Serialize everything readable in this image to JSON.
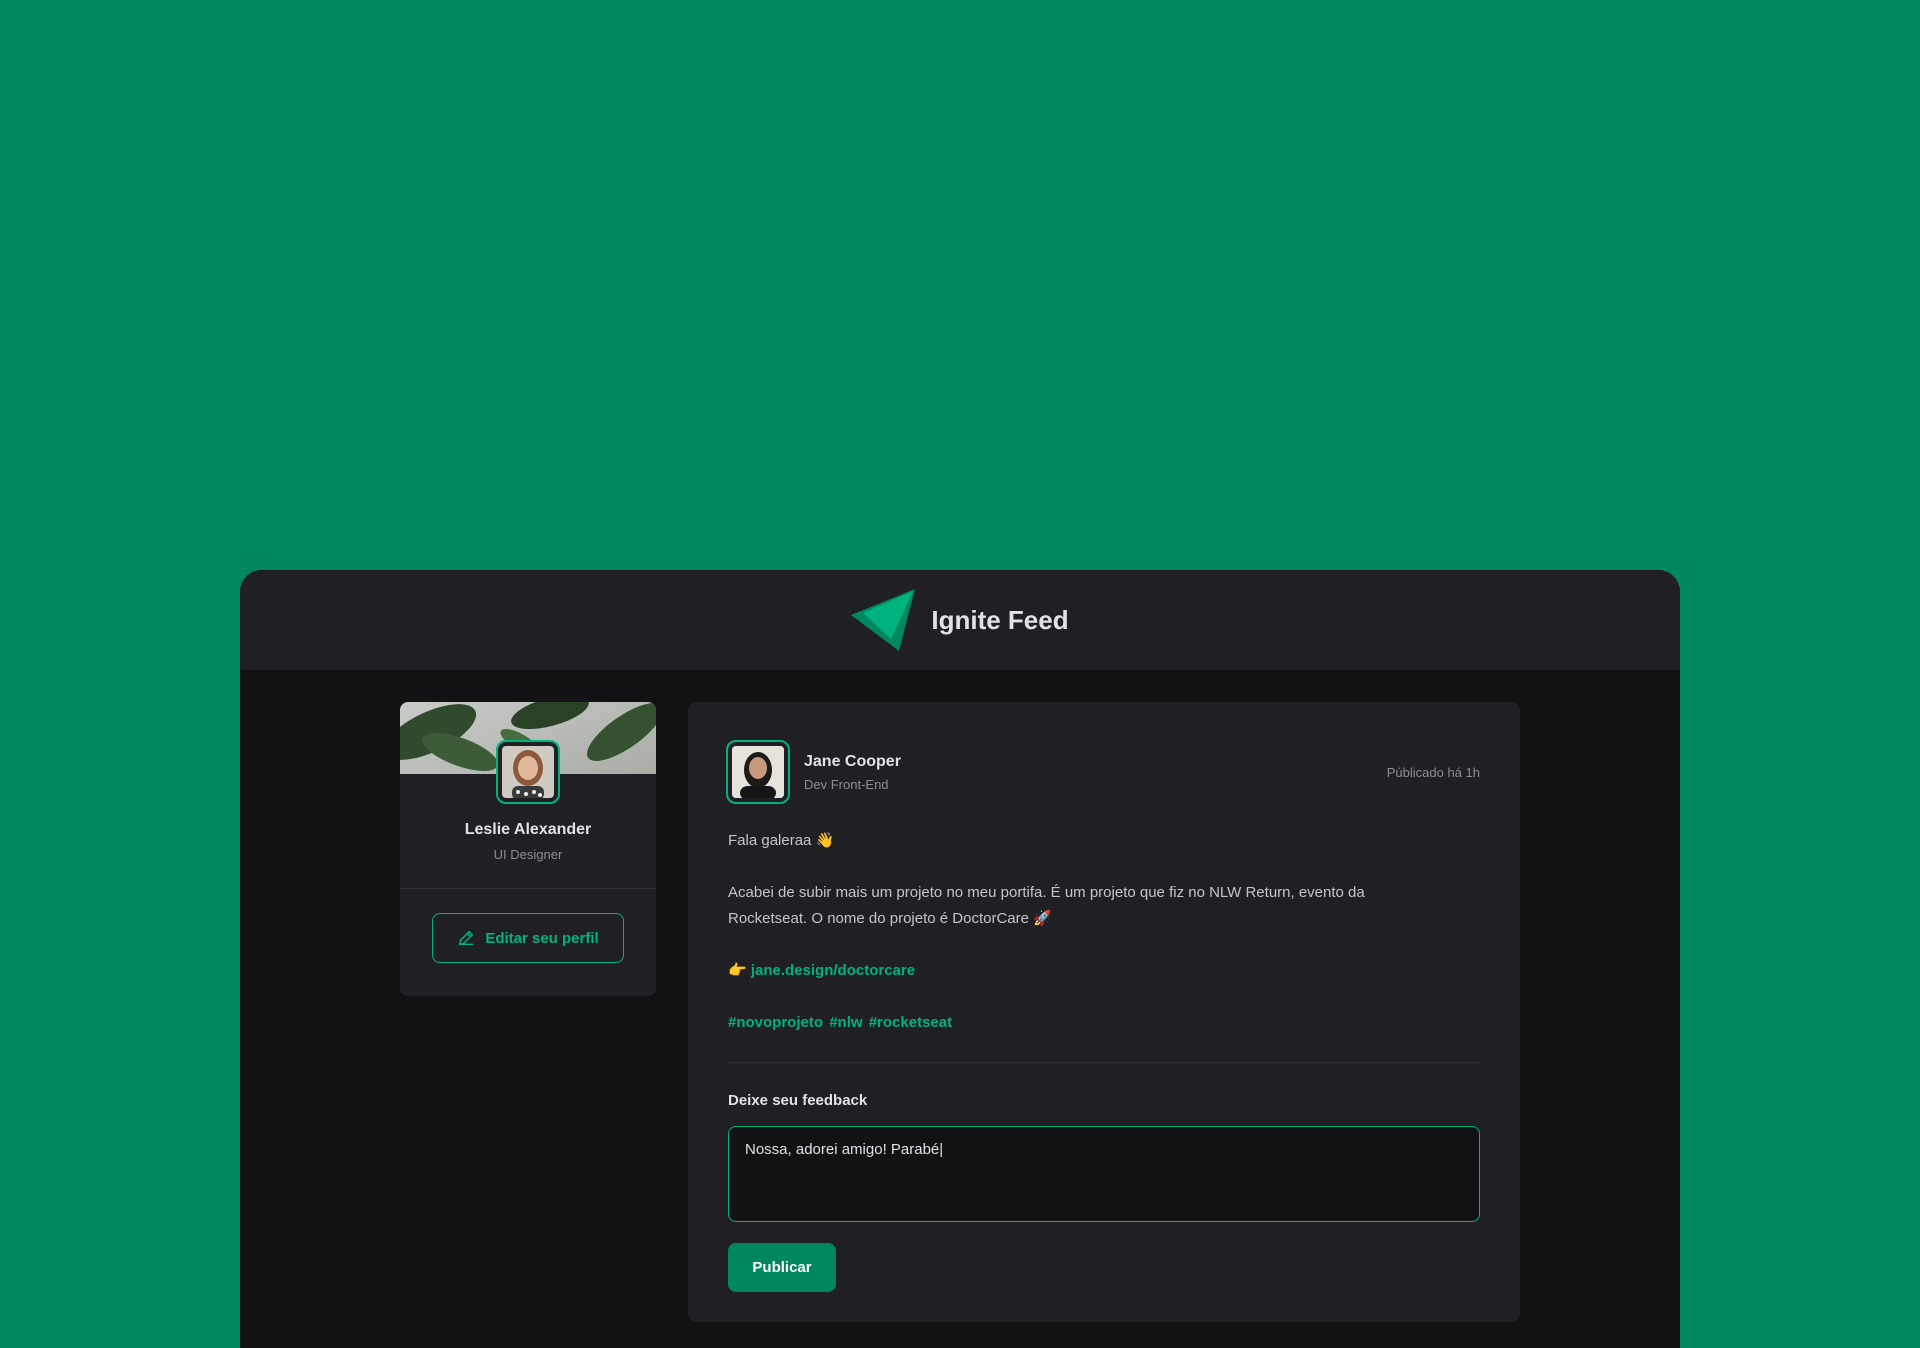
{
  "app": {
    "title": "Ignite Feed"
  },
  "colors": {
    "background": "#00875F",
    "accent": "#00B37E",
    "surface": "#202024",
    "base": "#121214"
  },
  "sidebar": {
    "name": "Leslie Alexander",
    "role": "UI Designer",
    "edit_label": "Editar seu perfil"
  },
  "post": {
    "author": {
      "name": "Jane Cooper",
      "role": "Dev Front-End"
    },
    "published": "Públicado há 1h",
    "greeting": "Fala galeraa 👋",
    "body_line1": "Acabei de subir mais um projeto no meu portifa. É um projeto que fiz no NLW Return, evento da",
    "body_line2": "Rocketseat. O nome do projeto é DoctorCare 🚀",
    "link_prefix": "👉 ",
    "link": "jane.design/doctorcare",
    "hashtags": [
      "#novoprojeto",
      "#nlw",
      "#rocketseat"
    ]
  },
  "feedback": {
    "title": "Deixe seu feedback",
    "value": "Nossa, adorei amigo! Parabé|",
    "publish_label": "Publicar"
  }
}
